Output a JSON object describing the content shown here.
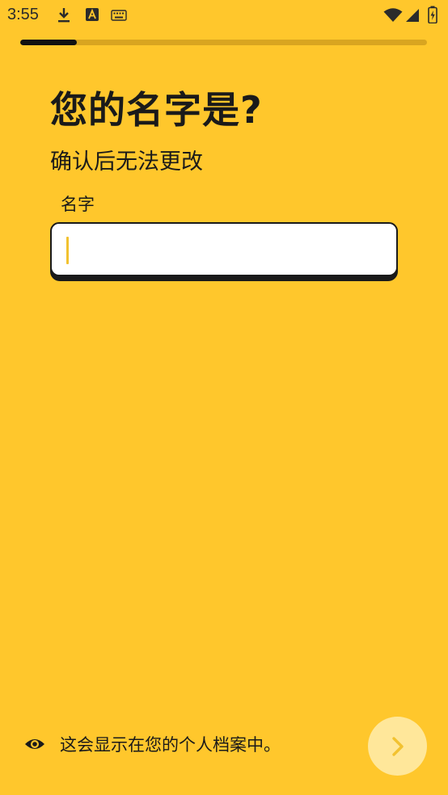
{
  "status_bar": {
    "time": "3:55",
    "icons": [
      "download-icon",
      "a-badge-icon",
      "keyboard-icon",
      "wifi-icon",
      "signal-icon",
      "battery-charging-icon"
    ]
  },
  "progress": {
    "value": 0.14
  },
  "header": {
    "title": "您的名字是?",
    "subtitle": "确认后无法更改"
  },
  "form": {
    "name_label": "名字",
    "name_value": "",
    "name_placeholder": ""
  },
  "footer": {
    "visibility_note": "这会显示在您的个人档案中。",
    "next_icon": "chevron-right-icon"
  },
  "colors": {
    "background": "#FFC72C",
    "progress_fill": "#111111",
    "next_button": "#FFE79A"
  }
}
